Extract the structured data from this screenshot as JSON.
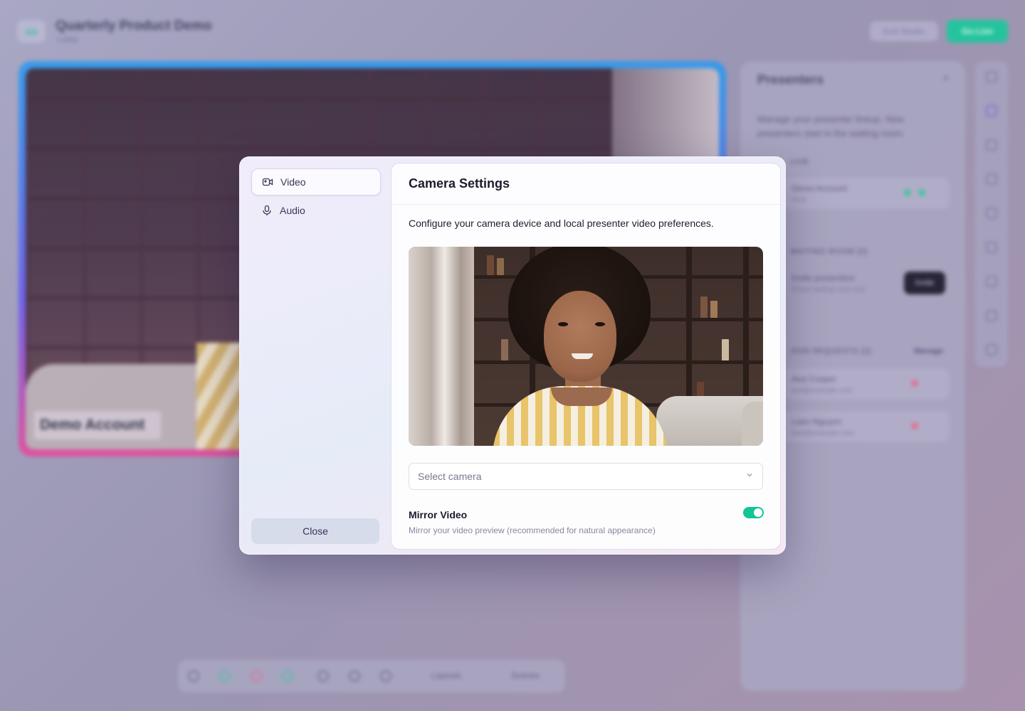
{
  "background": {
    "logo_text": "oo",
    "title": "Quarterly Product Demo",
    "subtitle": "Lobby",
    "exit_label": "Exit Studio",
    "golive_label": "Go Live",
    "name_tag": "Demo Account",
    "panel": {
      "title": "Presenters",
      "close_glyph": "×",
      "description": "Manage your presenter lineup. New presenters start in the waiting room.",
      "section_live": "LIVE",
      "section_waiting": "WAITING ROOM (0)",
      "section_requests": "JOIN REQUESTS (2)",
      "manage_label": "Manage",
      "invite_label": "Invite",
      "live_row": {
        "name": "Demo Account",
        "sub": "Host"
      },
      "waiting_row": {
        "name": "Invite presenters",
        "sub": "Share waiting room link"
      },
      "requests": [
        {
          "name": "Ava Cooper",
          "sub": "ava@example.com"
        },
        {
          "name": "Liam Nguyen",
          "sub": "liam@example.com"
        }
      ]
    },
    "toolbar": {
      "layouts_label": "Layouts",
      "scenes_label": "Scenes"
    }
  },
  "modal": {
    "sidebar": {
      "items": [
        {
          "label": "Video",
          "icon": "video-camera-icon",
          "active": true
        },
        {
          "label": "Audio",
          "icon": "microphone-icon",
          "active": false
        }
      ],
      "close_label": "Close"
    },
    "title": "Camera Settings",
    "description": "Configure your camera device and local presenter video preferences.",
    "camera_select": {
      "placeholder": "Select camera",
      "value": ""
    },
    "mirror": {
      "title": "Mirror Video",
      "description": "Mirror your video preview (recommended for natural appearance)",
      "enabled": true
    }
  },
  "colors": {
    "accent": "#12c596",
    "golive": "#18c99b",
    "text_primary": "#1c1b2e",
    "text_muted": "#8a879e"
  }
}
